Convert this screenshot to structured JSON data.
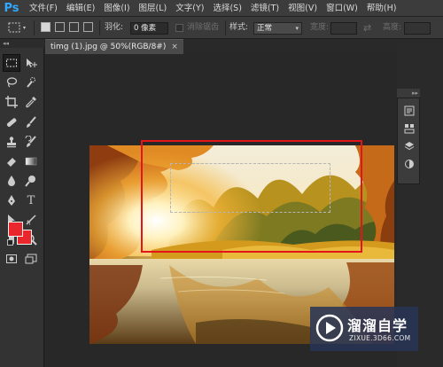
{
  "app": {
    "logo_text": "Ps"
  },
  "menu": {
    "items": [
      "文件(F)",
      "编辑(E)",
      "图像(I)",
      "图层(L)",
      "文字(Y)",
      "选择(S)",
      "滤镜(T)",
      "视图(V)",
      "窗口(W)",
      "帮助(H)"
    ]
  },
  "options_bar": {
    "feather_label": "羽化:",
    "feather_value": "0 像素",
    "antialias_label": "消除锯齿",
    "style_label": "样式:",
    "style_value": "正常",
    "width_label": "宽度:",
    "width_value": "",
    "height_label": "高度:",
    "height_value": ""
  },
  "document": {
    "tab_title": "timg (1).jpg @ 50%(RGB/8#)",
    "close_glyph": "×"
  },
  "toolbar": {
    "collapse_glyph": "◂◂",
    "foreground_color": "#e8262b",
    "background_color": "#e8262b"
  },
  "dock": {
    "collapse_glyph": "▸▸"
  },
  "watermark": {
    "title": "溜溜自学",
    "url": "ZIXUE.3D66.COM"
  },
  "colors": {
    "highlight_box": "#e4141b",
    "watermark_bg": "#283456"
  }
}
